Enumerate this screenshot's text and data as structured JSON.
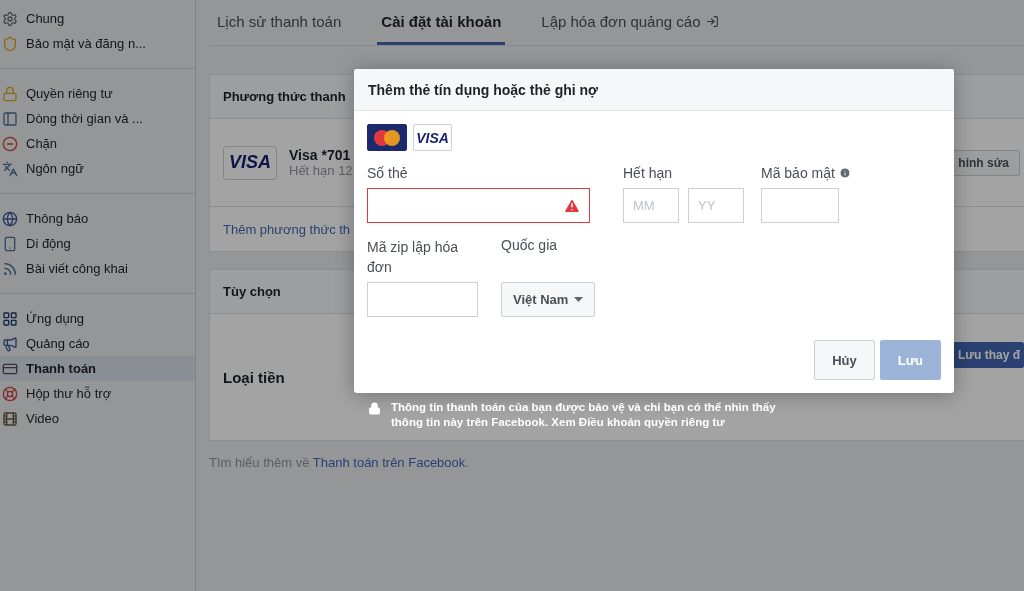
{
  "sidebar": {
    "groups": [
      [
        {
          "label": "Chung",
          "selected": false
        },
        {
          "label": "Bảo mật và đăng n...",
          "selected": false
        }
      ],
      [
        {
          "label": "Quyền riêng tư",
          "selected": false
        },
        {
          "label": "Dòng thời gian và ...",
          "selected": false
        },
        {
          "label": "Chặn",
          "selected": false
        },
        {
          "label": "Ngôn ngữ",
          "selected": false
        }
      ],
      [
        {
          "label": "Thông báo",
          "selected": false
        },
        {
          "label": "Di động",
          "selected": false
        },
        {
          "label": "Bài viết công khai",
          "selected": false
        }
      ],
      [
        {
          "label": "Ứng dụng",
          "selected": false
        },
        {
          "label": "Quảng cáo",
          "selected": false
        },
        {
          "label": "Thanh toán",
          "selected": true
        },
        {
          "label": "Hộp thư hỗ trợ",
          "selected": false
        },
        {
          "label": "Video",
          "selected": false
        }
      ]
    ]
  },
  "tabs": [
    {
      "label": "Lịch sử thanh toán",
      "selected": false
    },
    {
      "label": "Cài đặt tài khoản",
      "selected": true
    },
    {
      "label": "Lập hóa đơn quảng cáo",
      "selected": false,
      "external": true
    }
  ],
  "payment_card": {
    "header": "Phương thức thanh",
    "card_logo": "VISA",
    "card_name": "Visa *701",
    "card_expiry": "Hết hạn 12",
    "edit_button": "hỉnh sửa",
    "add_link": "Thêm phương thức th"
  },
  "options_card": {
    "header": "Tùy chọn",
    "currency_label": "Loại tiền",
    "save_button": "Lưu thay đ"
  },
  "footer": {
    "text": "Tìm hiểu thêm về ",
    "link": "Thanh toán trên Facebook",
    "end": "."
  },
  "modal": {
    "title": "Thêm thẻ tín dụng hoặc thẻ ghi nợ",
    "card_brands": [
      {
        "kind": "mastercard"
      },
      {
        "kind": "visa",
        "label": "VISA"
      }
    ],
    "card_number": {
      "label": "Số thẻ",
      "error": true
    },
    "expiry": {
      "label": "Hết hạn",
      "month_placeholder": "MM",
      "year_placeholder": "YY"
    },
    "security_code": {
      "label": "Mã bảo mật"
    },
    "zip": {
      "label": "Mã zip lập hóa đơn"
    },
    "country": {
      "label": "Quốc gia",
      "value": "Việt Nam"
    },
    "buttons": [
      {
        "label": "Hủy",
        "disabled": false,
        "primary": false
      },
      {
        "label": "Lưu",
        "disabled": true,
        "primary": true
      }
    ]
  },
  "security_note": "Thông tin thanh toán của bạn được bảo vệ và chỉ bạn có thể nhìn thấy thông tin này trên Facebook. Xem Điều khoản quyền riêng tư"
}
